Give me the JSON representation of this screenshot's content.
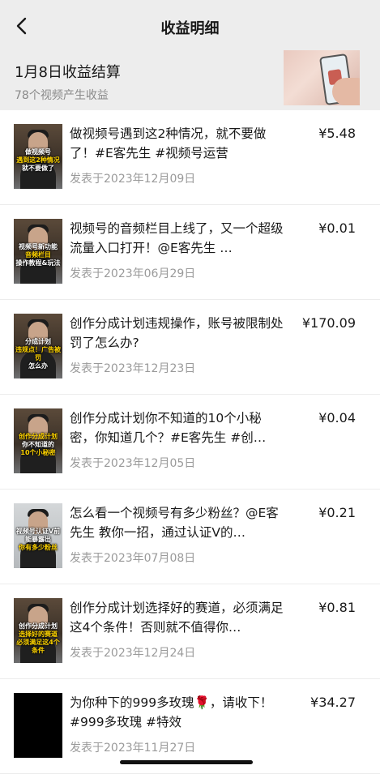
{
  "header": {
    "title": "收益明细"
  },
  "summary": {
    "title": "1月8日收益结算",
    "subtitle": "78个视频产生收益"
  },
  "items": [
    {
      "title": "做视频号遇到这2种情况，就不要做了！#E客先生 #视频号运营",
      "date": "发表于2023年12月09日",
      "amount": "¥5.48",
      "thumb_caption": [
        "做视频号",
        "遇到这2种情况",
        "就不要做了"
      ]
    },
    {
      "title": "视频号的音频栏目上线了，又一个超级流量入口打开！@E客先生 …",
      "date": "发表于2023年06月29日",
      "amount": "¥0.01",
      "thumb_caption": [
        "视频号新功能",
        "音频栏目",
        "操作教程&玩法"
      ]
    },
    {
      "title": "创作分成计划违规操作，账号被限制处罚了怎么办?",
      "date": "发表于2023年12月23日",
      "amount": "¥170.09",
      "thumb_caption": [
        "分成计划",
        "违规点！广告被罚",
        "怎么办"
      ]
    },
    {
      "title": "创作分成计划你不知道的10个小秘密，你知道几个？#E客先生 #创…",
      "date": "发表于2023年12月05日",
      "amount": "¥0.04",
      "thumb_caption": [
        "创作分成计划",
        "你不知道的",
        "10个小秘密"
      ]
    },
    {
      "title": "怎么看一个视频号有多少粉丝？@E客先生 教你一招，通过认证V的…",
      "date": "发表于2023年07月08日",
      "amount": "¥0.21",
      "thumb_caption": [
        "视频号认证V前",
        "能暴露出",
        "你有多少粉丝"
      ]
    },
    {
      "title": "创作分成计划选择好的赛道，必须满足这4个条件！否则就不值得你…",
      "date": "发表于2023年12月24日",
      "amount": "¥0.81",
      "thumb_caption": [
        "创作分成计划",
        "选择好的赛道",
        "必须满足这4个条件"
      ]
    },
    {
      "title": "为你种下的999多玫瑰🌹，请收下！ #999多玫瑰 #特效",
      "date": "发表于2023年11月27日",
      "amount": "¥34.27",
      "thumb_caption": []
    }
  ],
  "icons": {
    "back": "chevron-left-icon"
  }
}
